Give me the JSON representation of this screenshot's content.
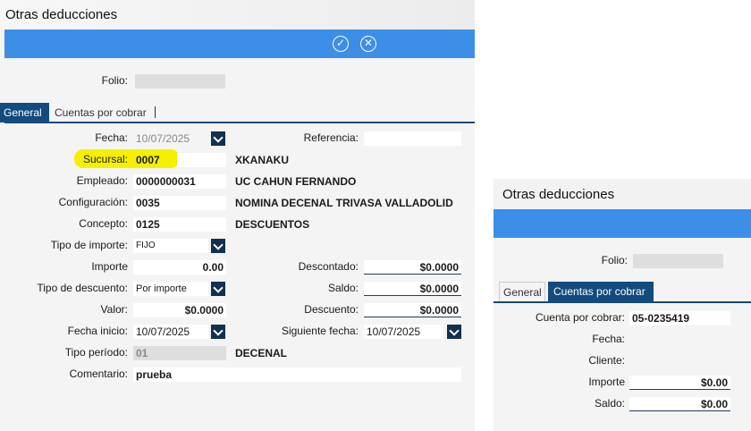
{
  "panel1": {
    "title": "Otras deducciones",
    "folio_label": "Folio:",
    "tabs": [
      "General",
      "Cuentas por cobrar"
    ],
    "fecha_label": "Fecha:",
    "fecha_value": "10/07/2025",
    "referencia_label": "Referencia:",
    "sucursal_label": "Sucursal:",
    "sucursal_value": "0007",
    "sucursal_name": "XKANAKU",
    "empleado_label": "Empleado:",
    "empleado_value": "0000000031",
    "empleado_name": "UC CAHUN FERNANDO",
    "configuracion_label": "Configuración:",
    "configuracion_value": "0035",
    "configuracion_name": "NOMINA DECENAL TRIVASA VALLADOLID",
    "concepto_label": "Concepto:",
    "concepto_value": "0125",
    "concepto_name": "DESCUENTOS",
    "tipo_importe_label": "Tipo de importe:",
    "tipo_importe_value": "FIJO",
    "importe_label": "Importe",
    "importe_value": "0.00",
    "descontado_label": "Descontado:",
    "descontado_value": "$0.0000",
    "tipo_descuento_label": "Tipo de descuento:",
    "tipo_descuento_value": "Por importe",
    "saldo_label": "Saldo:",
    "saldo_value": "$0.0000",
    "valor_label": "Valor:",
    "valor_value": "$0.0000",
    "descuento_label": "Descuento:",
    "descuento_value": "$0.0000",
    "fecha_inicio_label": "Fecha inicio:",
    "fecha_inicio_value": "10/07/2025",
    "siguiente_fecha_label": "Siguiente fecha:",
    "siguiente_fecha_value": "10/07/2025",
    "tipo_periodo_label": "Tipo período:",
    "tipo_periodo_value": "01",
    "tipo_periodo_name": "DECENAL",
    "comentario_label": "Comentario:",
    "comentario_value": "prueba"
  },
  "panel2": {
    "title": "Otras deducciones",
    "folio_label": "Folio:",
    "tabs": [
      "General",
      "Cuentas por cobrar"
    ],
    "cuenta_label": "Cuenta por cobrar:",
    "cuenta_value": "05-0235419",
    "fecha_label": "Fecha:",
    "cliente_label": "Cliente:",
    "importe_label": "Importe",
    "importe_value": "$0.00",
    "saldo_label": "Saldo:",
    "saldo_value": "$0.00"
  },
  "icons": {
    "accept": "check-circle-icon",
    "cancel": "x-circle-icon",
    "dropdown": "chevron-down-icon"
  },
  "colors": {
    "toolbar": "#3d8ee7",
    "tab_active": "#134b7e",
    "highlight": "#f4f000"
  }
}
